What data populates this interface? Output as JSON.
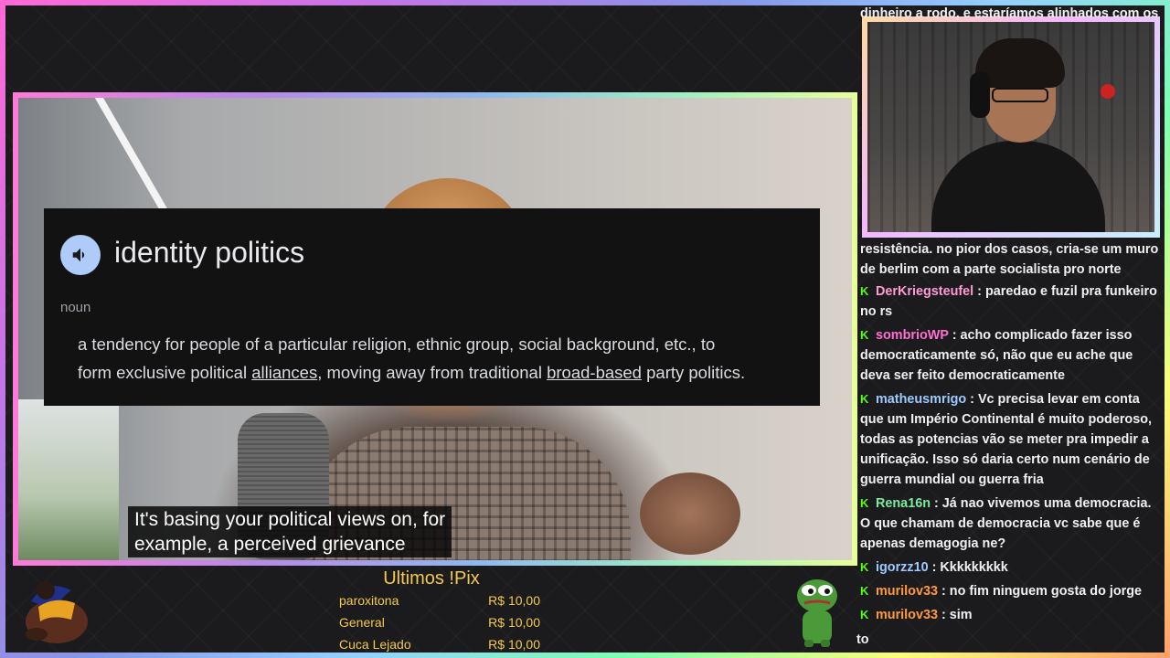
{
  "dictionary": {
    "term": "identity politics",
    "part_of_speech": "noun",
    "definition": {
      "line1": "a tendency for people of a particular religion, ethnic group, social background, etc., to",
      "line2_before": "form exclusive political ",
      "line2_link1": "alliances",
      "line2_middle": ", moving away from traditional ",
      "line2_link2": "broad-based",
      "line2_after": " party politics."
    }
  },
  "subtitle": {
    "line1": "It's basing your political views on, for",
    "line2": "example, a perceived grievance"
  },
  "pix": {
    "title": "Ultimos !Pix",
    "donations": [
      {
        "name": "paroxitona",
        "amount": "R$ 10,00"
      },
      {
        "name": "General",
        "amount": "R$ 10,00"
      },
      {
        "name": "Cuca Lejado",
        "amount": "R$ 10,00"
      }
    ]
  },
  "chat": {
    "top_fragment": "dinheiro a rodo, e estaríamos alinhados com os",
    "fragment_line1": "resistência. no pior dos casos, cria-se um muro",
    "fragment_line2": "de berlim com a parte socialista pro norte",
    "messages": [
      {
        "user": "DerKriegsteufel",
        "color": "#ff9bd2",
        "text": "paredao e fuzil pra funkeiro no rs"
      },
      {
        "user": "sombrioWP",
        "color": "#ff6fd0",
        "text": "acho complicado fazer isso democraticamente só, não que eu ache que deva ser feito democraticamente"
      },
      {
        "user": "matheusmrigo",
        "color": "#9ecbff",
        "text": "Vc precisa levar em conta que um Império Continental é muito poderoso, todas as potencias vão se meter pra impedir a unificação. Isso só daria certo num cenário de guerra mundial ou guerra fria"
      },
      {
        "user": "Rena16n",
        "color": "#7de8a0",
        "text": "Já nao vivemos uma democracia. O que chamam de democracia vc sabe que é apenas demagogia ne?"
      },
      {
        "user": "igorzz10",
        "color": "#9ecbff",
        "text": "Kkkkkkkkk"
      },
      {
        "user": "murilov33",
        "color": "#ff9a3c",
        "text": "no fim ninguem gosta do jorge"
      },
      {
        "user": "murilov33",
        "color": "#ff9a3c",
        "text": "sim"
      }
    ],
    "bottom_fragment": "to",
    "badge_glyph": "K",
    "separator": " : "
  }
}
